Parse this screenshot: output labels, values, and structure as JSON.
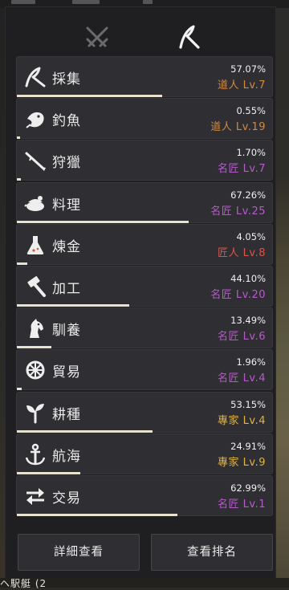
{
  "tabs": [
    {
      "icon": "crossed-swords-icon",
      "active": false
    },
    {
      "icon": "scythe-icon",
      "active": true
    }
  ],
  "skills": [
    {
      "icon": "scythe-icon",
      "name": "採集",
      "percent": "57.07%",
      "percent_value": 0.5707,
      "rank": "道人",
      "level": "Lv.7",
      "level_text": "道人 Lv.7",
      "color": "#d08a3f"
    },
    {
      "icon": "fish-icon",
      "name": "釣魚",
      "percent": "0.55%",
      "percent_value": 0.0055,
      "rank": "道人",
      "level": "Lv.19",
      "level_text": "道人 Lv.19",
      "color": "#d08a3f"
    },
    {
      "icon": "hunting-rifle-icon",
      "name": "狩獵",
      "percent": "1.70%",
      "percent_value": 0.017,
      "rank": "名匠",
      "level": "Lv.7",
      "level_text": "名匠 Lv.7",
      "color": "#b65acb"
    },
    {
      "icon": "cooking-pot-icon",
      "name": "料理",
      "percent": "67.26%",
      "percent_value": 0.6726,
      "rank": "名匠",
      "level": "Lv.25",
      "level_text": "名匠 Lv.25",
      "color": "#b65acb"
    },
    {
      "icon": "alchemy-flask-icon",
      "name": "煉金",
      "percent": "4.05%",
      "percent_value": 0.0405,
      "rank": "匠人",
      "level": "Lv.8",
      "level_text": "匠人 Lv.8",
      "color": "#d8554a"
    },
    {
      "icon": "hammer-icon",
      "name": "加工",
      "percent": "44.10%",
      "percent_value": 0.441,
      "rank": "名匠",
      "level": "Lv.20",
      "level_text": "名匠 Lv.20",
      "color": "#b65acb"
    },
    {
      "icon": "horse-head-icon",
      "name": "馴養",
      "percent": "13.49%",
      "percent_value": 0.1349,
      "rank": "名匠",
      "level": "Lv.6",
      "level_text": "名匠 Lv.6",
      "color": "#b65acb"
    },
    {
      "icon": "ship-wheel-icon",
      "name": "貿易",
      "percent": "1.96%",
      "percent_value": 0.0196,
      "rank": "名匠",
      "level": "Lv.4",
      "level_text": "名匠 Lv.4",
      "color": "#b65acb"
    },
    {
      "icon": "sprout-icon",
      "name": "耕種",
      "percent": "53.15%",
      "percent_value": 0.5315,
      "rank": "專家",
      "level": "Lv.4",
      "level_text": "專家 Lv.4",
      "color": "#e0b341"
    },
    {
      "icon": "anchor-icon",
      "name": "航海",
      "percent": "24.91%",
      "percent_value": 0.2491,
      "rank": "專家",
      "level": "Lv.9",
      "level_text": "專家 Lv.9",
      "color": "#e0b341"
    },
    {
      "icon": "exchange-arrows-icon",
      "name": "交易",
      "percent": "62.99%",
      "percent_value": 0.6299,
      "rank": "名匠",
      "level": "Lv.1",
      "level_text": "名匠 Lv.1",
      "color": "#b65acb"
    }
  ],
  "buttons": {
    "details": "詳細查看",
    "ranking": "查看排名"
  },
  "footer_fragment": "ヘ駅艇 (2"
}
